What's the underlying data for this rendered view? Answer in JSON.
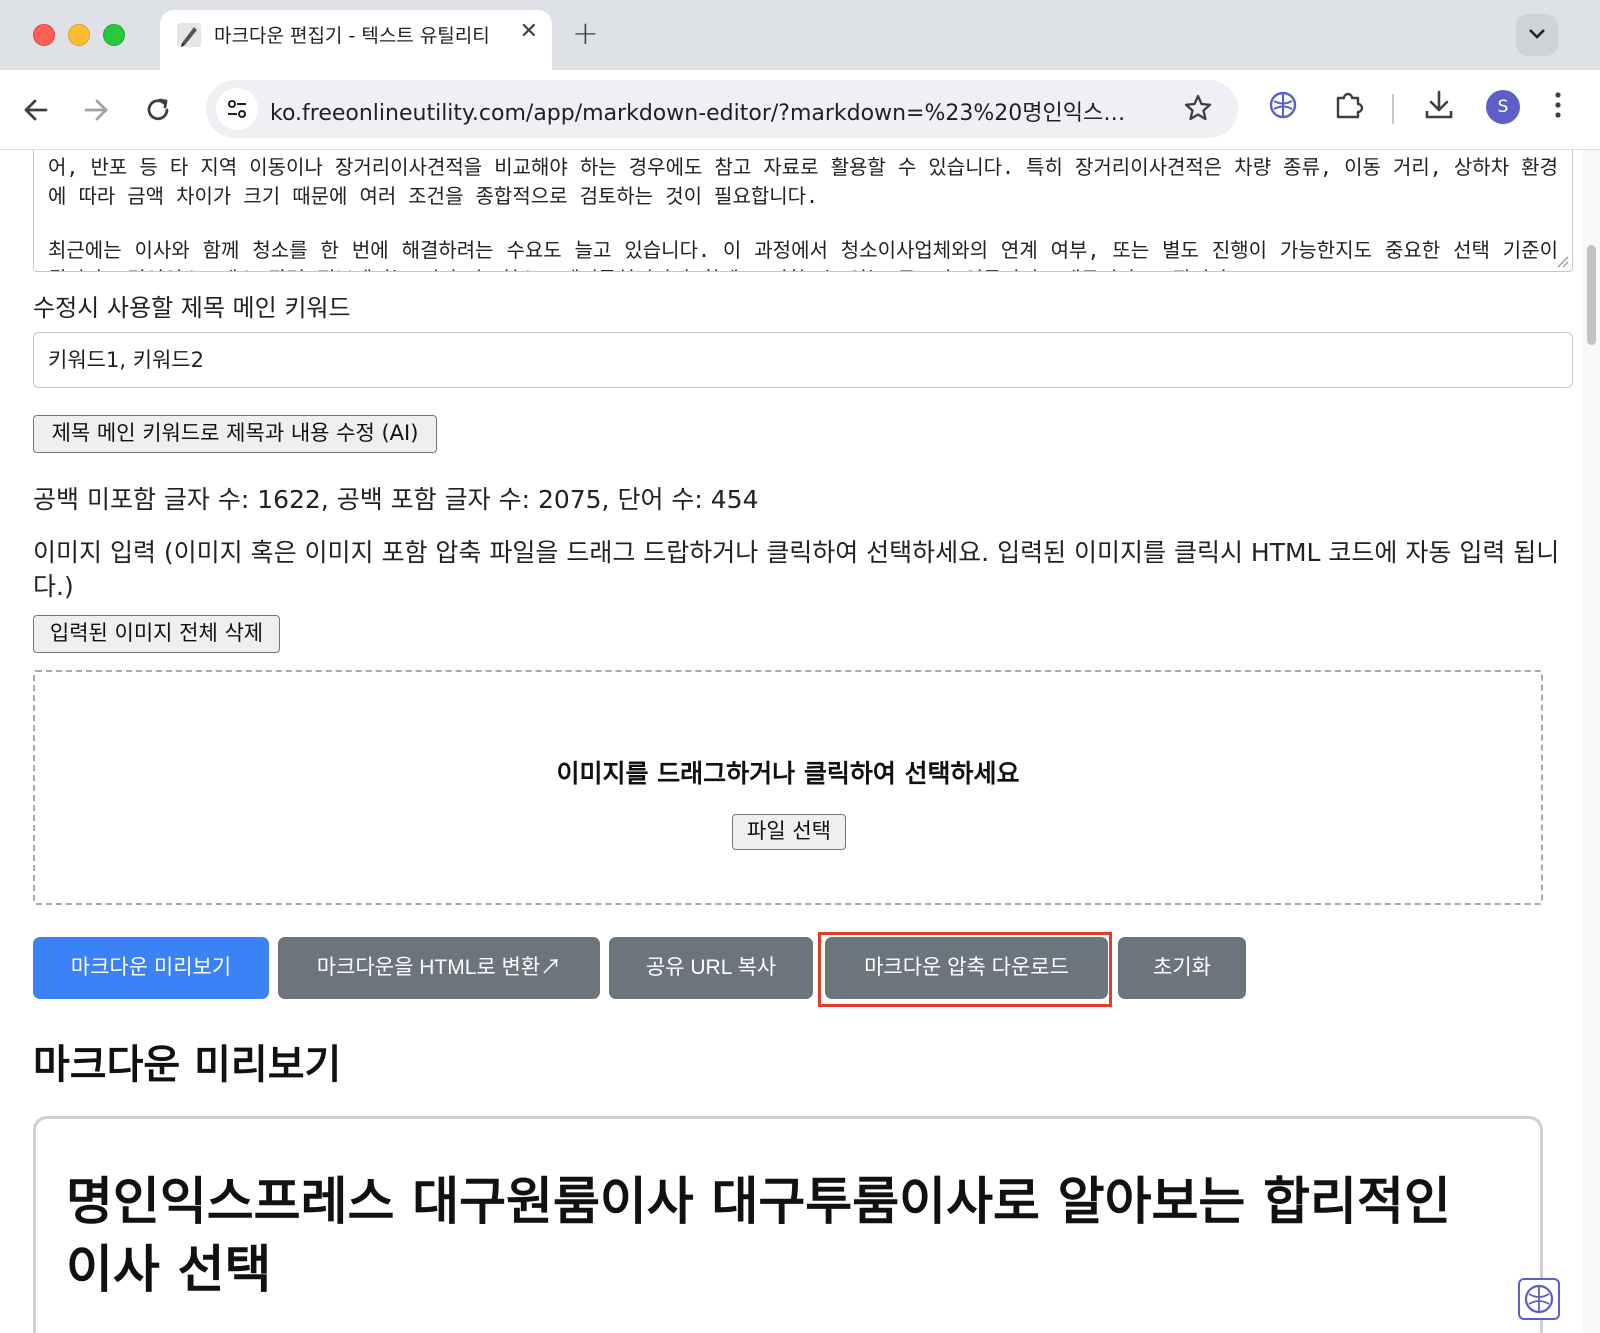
{
  "browser": {
    "tab_title": "마크다운 편집기 - 텍스트 유틸리티",
    "url": "ko.freeonlineutility.com/app/markdown-editor/?markdown=%23%20명인익스…",
    "profile_initial": "S"
  },
  "editor": {
    "paragraphs": [
      "어, 반포 등 타 지역 이동이나 장거리이사견적을 비교해야 하는 경우에도 참고 자료로 활용할 수 있습니다. 특히 장거리이사견적은 차량 종류, 이동 거리, 상하차 환경에 따라 금액 차이가 크기 때문에 여러 조건을 종합적으로 검토하는 것이 필요합니다.",
      "최근에는 이사와 함께 청소를 한 번에 해결하려는 수요도 늘고 있습니다. 이 과정에서 청소이사업체와의 연계 여부, 또는 별도 진행이 가능한지도 중요한 선택 기준이 됩니다. 명인익스프레스 관련 정보에서는 이사 후 청소, 폐기물처리까지 함께 고려할 수 있는 구조가 언급되며, 대구이파트포장이사"
    ]
  },
  "keyword": {
    "label": "수정시 사용할 제목 메인 키워드",
    "value": "키워드1, 키워드2",
    "ai_button": "제목 메인 키워드로 제목과 내용 수정 (AI)"
  },
  "stats": {
    "text": "공백 미포함 글자 수: 1622, 공백 포함 글자 수: 2075, 단어 수: 454"
  },
  "images": {
    "description": "이미지 입력 (이미지 혹은 이미지 포함 압축 파일을 드래그 드랍하거나 클릭하여 선택하세요. 입력된 이미지를 클릭시 HTML 코드에 자동 입력 됩니다.)",
    "delete_all_button": "입력된 이미지 전체 삭제",
    "dropzone_text": "이미지를 드래그하거나 클릭하여 선택하세요",
    "file_button": "파일 선택"
  },
  "actions": {
    "preview": "마크다운 미리보기",
    "to_html": "마크다운을 HTML로 변환↗",
    "copy_url": "공유 URL 복사",
    "download_zip": "마크다운 압축 다운로드",
    "reset": "초기화"
  },
  "preview": {
    "section_title": "마크다운 미리보기",
    "h1": "명인익스프레스 대구원룸이사 대구투룸이사로 알아보는 합리적인 이사 선택"
  },
  "colors": {
    "primary": "#3b82f6",
    "secondary": "#6c757d",
    "highlight": "#e23c2a"
  },
  "icons": [
    "back-icon",
    "forward-icon",
    "reload-icon",
    "site-info-icon",
    "bookmark-star-icon",
    "ai-brain-extension-icon",
    "puzzle-extensions-icon",
    "download-icon",
    "menu-kebab-icon"
  ]
}
